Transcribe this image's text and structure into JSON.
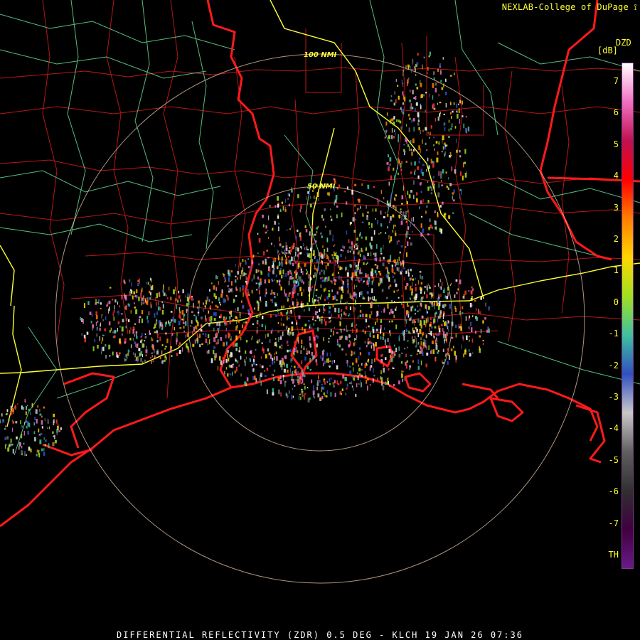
{
  "header": {
    "credit": "NEXLAB-College of DuPage"
  },
  "footer": {
    "caption": "DIFFERENTIAL REFLECTIVITY (ZDR) 0.5 DEG - KLCH 19 JAN 26 07:36"
  },
  "map": {
    "radar_site": "KLCH",
    "range_rings": [
      {
        "label": "50 NMI"
      },
      {
        "label": "100 NMI"
      }
    ]
  },
  "colorbar": {
    "product": "DZD",
    "unit": "[dB]",
    "ticks": [
      "7",
      "6",
      "5",
      "4",
      "3",
      "2",
      "1",
      "0",
      "-1",
      "-2",
      "-3",
      "-4",
      "-5",
      "-6",
      "-7",
      "TH"
    ],
    "stops": [
      "#ffffff",
      "#f070c0",
      "#c01050",
      "#ff0000",
      "#ff7f00",
      "#ffd700",
      "#a0e020",
      "#40c0a0",
      "#3050c0",
      "#c8c8c8",
      "#606060",
      "#303030",
      "#400040",
      "#6a1a8a"
    ]
  },
  "colors": {
    "coast": "#ff1a1a",
    "parish_lines": "#b81818",
    "roads": "#5fd38f",
    "interstates": "#ffff33",
    "range_ring": "#e8c8a8"
  }
}
